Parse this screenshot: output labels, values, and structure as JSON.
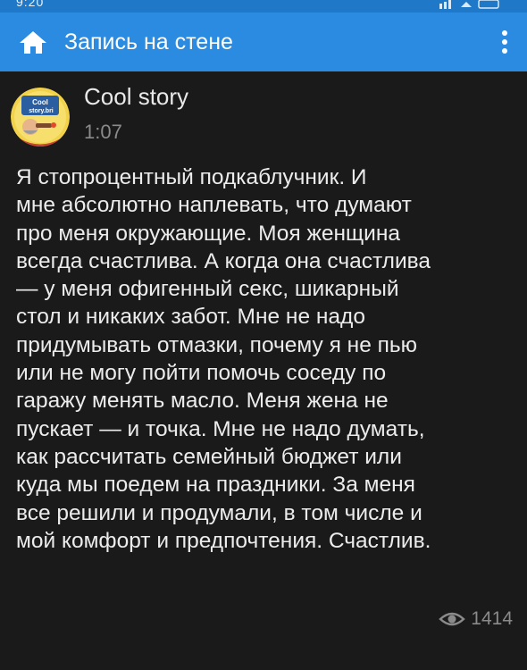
{
  "status_bar": {
    "time": "9:20"
  },
  "app_bar": {
    "title": "Запись на стене",
    "home_icon": "home-icon",
    "menu_icon": "more-vertical-icon"
  },
  "post": {
    "author": "Cool story",
    "avatar_text": [
      "Cool",
      "story.bri"
    ],
    "time": "1:07",
    "text": "Я стопроцентный подкаблучник. И\nмне абсолютно наплевать, что думают\nпро меня окружающие. Моя женщина\nвсегда счастлива. А когда она счастлива\n— у меня офигенный секс, шикарный\nстол и никаких забот. Мне не надо\nпридумывать отмазки, почему я не пью\nили не могу пойти помочь соседу по\nгаражу менять масло. Меня жена не\nпускает — и точка. Мне не надо думать,\nкак рассчитать семейный бюджет или\nкуда мы поедем на праздники. За меня\nвсе решили и продумали, в том числе и\nмой комфорт и предпочтения. Счастлив.",
    "views": "1414",
    "views_icon": "eye-icon"
  },
  "colors": {
    "app_bar": "#2b8be0",
    "status_bar": "#1f78c8",
    "background": "#1a1a1a",
    "text": "#ececec",
    "muted": "#8b8b8b"
  }
}
